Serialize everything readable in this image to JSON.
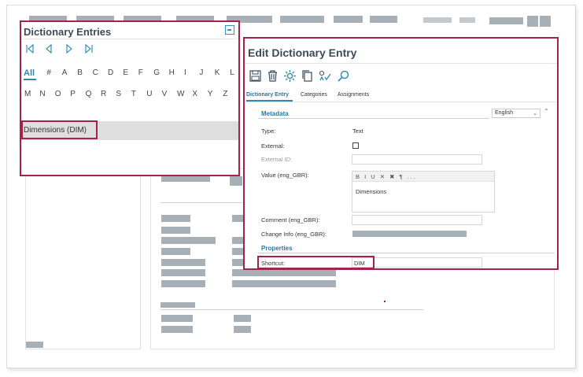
{
  "dictionary_panel": {
    "title": "Dictionary Entries",
    "nav": [
      "first",
      "previous",
      "next",
      "last"
    ],
    "letters_row1": [
      "All",
      "#",
      "A",
      "B",
      "C",
      "D",
      "E",
      "F",
      "G",
      "H",
      "I",
      "J",
      "K",
      "L"
    ],
    "letters_row2": [
      "M",
      "N",
      "O",
      "P",
      "Q",
      "R",
      "S",
      "T",
      "U",
      "V",
      "W",
      "X",
      "Y",
      "Z"
    ],
    "selected_letter": "All",
    "entries": [
      {
        "label": "Dimensions (DIM)"
      }
    ]
  },
  "edit_panel": {
    "title": "Edit Dictionary Entry",
    "toolbar": [
      "save-icon",
      "delete-icon",
      "gear-icon",
      "copy-icon",
      "check-icon",
      "search-icon"
    ],
    "tabs": [
      "Dictionary Entry",
      "Categories",
      "Assignments"
    ],
    "active_tab": "Dictionary Entry",
    "metadata": {
      "section_title": "Metadata",
      "language": "English",
      "type_label": "Type:",
      "type_value": "Text",
      "external_label": "External:",
      "external_checked": false,
      "external_id_label": "External ID:",
      "external_id_value": "",
      "value_label": "Value (eng_GBR):",
      "value_text": "Dimensions",
      "rte_tools": "B I U ✕ ✖ ¶ ...",
      "comment_label": "Comment (eng_GBR):",
      "comment_value": "",
      "change_info_label": "Change Info (eng_GBR):"
    },
    "properties": {
      "section_title": "Properties",
      "shortcut_label": "Shortcut:",
      "shortcut_value": "DIM"
    }
  },
  "colors": {
    "highlight_border": "#a3234b",
    "accent_blue": "#2a88b1",
    "placeholder_grey": "#a7b0b6"
  }
}
